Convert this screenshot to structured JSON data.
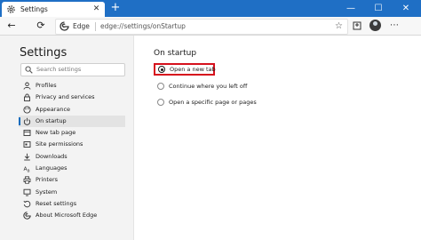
{
  "tab": {
    "title": "Settings",
    "close_glyph": "✕"
  },
  "new_tab_glyph": "+",
  "window": {
    "minimize": "—",
    "maximize": "☐",
    "close": "✕"
  },
  "toolbar": {
    "back_glyph": "←",
    "refresh_glyph": "⟳"
  },
  "address": {
    "brand": "Edge",
    "url": "edge://settings/onStartup"
  },
  "sidebar": {
    "title": "Settings",
    "search_placeholder": "Search settings",
    "items": [
      {
        "label": "Profiles",
        "icon": "person-icon"
      },
      {
        "label": "Privacy and services",
        "icon": "lock-icon"
      },
      {
        "label": "Appearance",
        "icon": "appearance-icon"
      },
      {
        "label": "On startup",
        "icon": "power-icon",
        "active": true
      },
      {
        "label": "New tab page",
        "icon": "new-tab-page-icon"
      },
      {
        "label": "Site permissions",
        "icon": "site-permissions-icon"
      },
      {
        "label": "Downloads",
        "icon": "download-icon"
      },
      {
        "label": "Languages",
        "icon": "languages-icon"
      },
      {
        "label": "Printers",
        "icon": "printer-icon"
      },
      {
        "label": "System",
        "icon": "system-icon"
      },
      {
        "label": "Reset settings",
        "icon": "reset-icon"
      },
      {
        "label": "About Microsoft Edge",
        "icon": "edge-logo-icon"
      }
    ]
  },
  "main": {
    "title": "On startup",
    "options": [
      {
        "label": "Open a new tab",
        "selected": true
      },
      {
        "label": "Continue where you left off",
        "selected": false
      },
      {
        "label": "Open a specific page or pages",
        "selected": false
      }
    ]
  },
  "colors": {
    "titlebar": "#1f6fc5",
    "accent": "#0f6cbd",
    "highlight_box": "#d6111d",
    "sidebar_bg": "#f3f3f3"
  }
}
